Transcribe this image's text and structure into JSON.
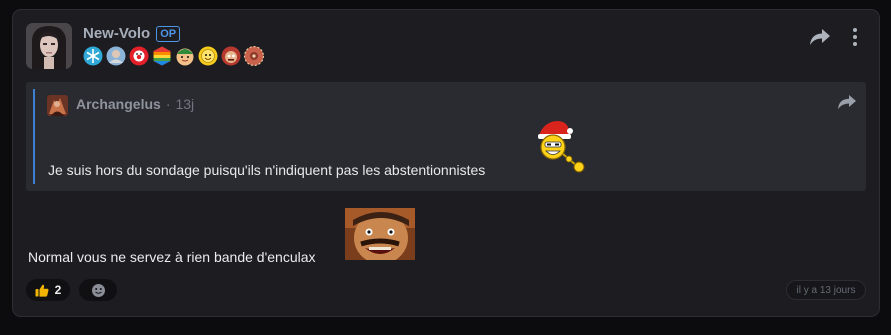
{
  "post": {
    "author": "New-Volo",
    "op_badge": "OP",
    "badges": [
      "snowflake-badge",
      "portrait-badge",
      "clown-badge",
      "rainbow-badge",
      "elf-badge",
      "smiley-badge",
      "monster-badge",
      "spiral-badge"
    ],
    "body": "Normal vous ne servez à rien bande d'enculax",
    "timestamp": "il y a 13 jours"
  },
  "quote": {
    "author": "Archangelus",
    "separator": "·",
    "time": "13j",
    "text": "Je suis hors du sondage puisqu'ils n'indiquent pas les abstentionnistes"
  },
  "reactions": {
    "thumbs_up_count": "2"
  },
  "colors": {
    "accent": "#4f95e8",
    "quote_bar": "#3d7fd0",
    "card_bg": "#1c1c21",
    "quote_bg": "#2a2b31"
  }
}
